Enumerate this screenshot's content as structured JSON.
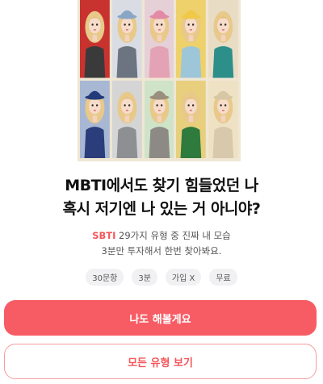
{
  "hero": {
    "image": "mbti-character-collage",
    "tiles": [
      {
        "bg": "#c8322f",
        "outfit": "#3a3a3a",
        "hat": "none"
      },
      {
        "bg": "#d9dde3",
        "outfit": "#6b7480",
        "hat": "#8aa6c7"
      },
      {
        "bg": "#e5d0d7",
        "outfit": "#e4a2b5",
        "hat": "#e28aa6"
      },
      {
        "bg": "#efd16b",
        "outfit": "#9ec6d9",
        "hat": "#f0c84a"
      },
      {
        "bg": "#e9dcc5",
        "outfit": "#2d8f8a",
        "hat": "none"
      },
      {
        "bg": "#a8b7d4",
        "outfit": "#2b3d7a",
        "hat": "#233a7a"
      },
      {
        "bg": "#d5d5d5",
        "outfit": "#8d8f92",
        "hat": "none"
      },
      {
        "bg": "#cfe3c9",
        "outfit": "#8d8a86",
        "hat": "#9a8f7c"
      },
      {
        "bg": "#e8cf7d",
        "outfit": "#2f7a3d",
        "hat": "none"
      },
      {
        "bg": "#efe2c4",
        "outfit": "#d9c9ac",
        "hat": "#d8c7a5"
      }
    ]
  },
  "headline": {
    "line1": "MBTI에서도 찾기 힘들었던 나",
    "line2": "혹시 저기엔 나 있는 거 아니야?"
  },
  "subtitle": {
    "accent": "SBTI",
    "line1_rest": " 29가지 유형 중 진짜 내 모습",
    "line2": "3분만 투자해서 한번 찾아봐요."
  },
  "chips": [
    "30문항",
    "3분",
    "가입 X",
    "무료"
  ],
  "buttons": {
    "primary": "나도 해볼게요",
    "secondary": "모든 유형 보기"
  },
  "colors": {
    "accent": "#f4565b",
    "primary_button": "#f75c64",
    "chip_bg": "#f1f1f3"
  }
}
